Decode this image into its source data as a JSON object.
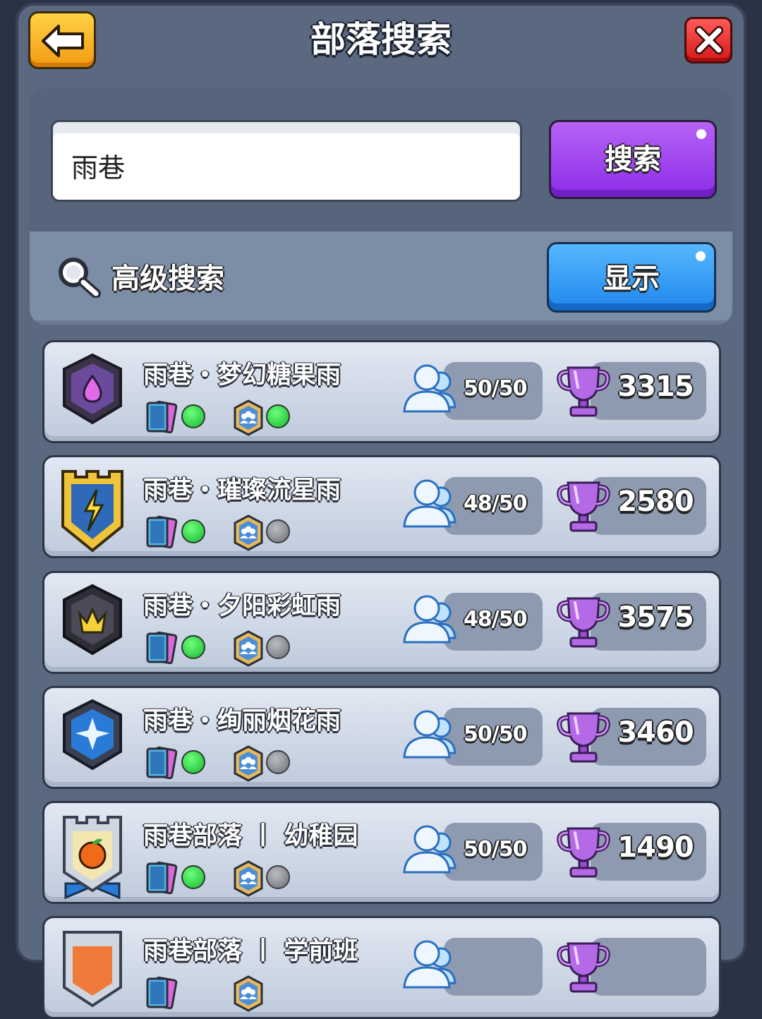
{
  "header": {
    "title": "部落搜索"
  },
  "search": {
    "query": "雨巷",
    "button_label": "搜索"
  },
  "advanced": {
    "label": "高级搜索",
    "button_label": "显示"
  },
  "clans": [
    {
      "name": "雨巷・梦幻糖果雨",
      "members": "50/50",
      "trophies": "3315",
      "status_a": "on",
      "status_b": "on",
      "badge": "purple-shield"
    },
    {
      "name": "雨巷・璀璨流星雨",
      "members": "48/50",
      "trophies": "2580",
      "status_a": "on",
      "status_b": "off",
      "badge": "gold-lightning"
    },
    {
      "name": "雨巷・夕阳彩虹雨",
      "members": "48/50",
      "trophies": "3575",
      "status_a": "on",
      "status_b": "off",
      "badge": "dark-crown"
    },
    {
      "name": "雨巷・绚丽烟花雨",
      "members": "50/50",
      "trophies": "3460",
      "status_a": "on",
      "status_b": "off",
      "badge": "blue-star"
    },
    {
      "name": "雨巷部落 丨 幼稚园",
      "members": "50/50",
      "trophies": "1490",
      "status_a": "on",
      "status_b": "off",
      "badge": "silver-orange"
    },
    {
      "name": "雨巷部落 丨 学前班",
      "members": "",
      "trophies": "",
      "status_a": "",
      "status_b": "",
      "badge": "orange-banner"
    }
  ],
  "colors": {
    "purple": "#8d2ce8",
    "blue": "#1f86ec",
    "gold": "#f39a12",
    "red": "#d41a1a",
    "green": "#16b82e"
  }
}
